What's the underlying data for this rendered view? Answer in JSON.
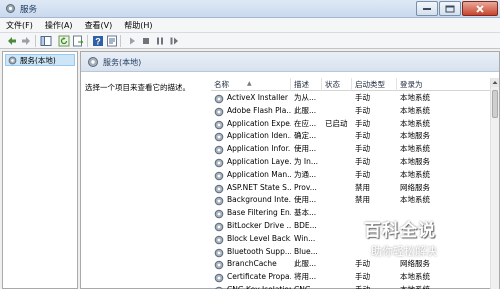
{
  "window": {
    "title": "服务",
    "controls": [
      "minimize-icon",
      "maximize-icon",
      "close-icon"
    ]
  },
  "menu": [
    "文件(F)",
    "操作(A)",
    "查看(V)",
    "帮助(H)"
  ],
  "toolbar": {
    "icons": [
      "back-arrow-icon",
      "forward-arrow-icon",
      "console-tree-icon",
      "refresh-icon",
      "export-list-icon",
      "help-icon",
      "properties-icon",
      "start-service-icon",
      "stop-service-icon",
      "pause-service-icon",
      "restart-service-icon"
    ]
  },
  "tree": {
    "item_label": "服务(本地)"
  },
  "main": {
    "header_title": "服务(本地)",
    "description_hint": "选择一个项目来查看它的描述。"
  },
  "table": {
    "columns": [
      "名称",
      "描述",
      "状态",
      "启动类型",
      "登录为"
    ],
    "rows": [
      [
        "ActiveX Installer ...",
        "为从...",
        "",
        "手动",
        "本地系统"
      ],
      [
        "Adobe Flash Pla...",
        "此服...",
        "",
        "手动",
        "本地系统"
      ],
      [
        "Application Expe...",
        "在应...",
        "已启动",
        "手动",
        "本地系统"
      ],
      [
        "Application Iden...",
        "确定...",
        "",
        "手动",
        "本地服务"
      ],
      [
        "Application Infor...",
        "使用...",
        "",
        "手动",
        "本地系统"
      ],
      [
        "Application Laye...",
        "为 In...",
        "",
        "手动",
        "本地服务"
      ],
      [
        "Application Man...",
        "为通...",
        "",
        "手动",
        "本地系统"
      ],
      [
        "ASP.NET State S...",
        "Prov...",
        "",
        "禁用",
        "网络服务"
      ],
      [
        "Background Inte...",
        "使用...",
        "",
        "禁用",
        "本地系统"
      ],
      [
        "Base Filtering En...",
        "基本...",
        "",
        "",
        ""
      ],
      [
        "BitLocker Drive ...",
        "BDE...",
        "",
        "",
        ""
      ],
      [
        "Block Level Back...",
        "Win...",
        "",
        "",
        ""
      ],
      [
        "Bluetooth Supp...",
        "Blue...",
        "",
        "",
        ""
      ],
      [
        "BranchCache",
        "此服...",
        "",
        "手动",
        "网络服务"
      ],
      [
        "Certificate Propa...",
        "将用...",
        "",
        "手动",
        "本地系统"
      ],
      [
        "CNG Key Isolation",
        "CNG...",
        "",
        "手动",
        "本地系统"
      ]
    ]
  },
  "watermark": {
    "title": "百科全说",
    "subtitle": "助你轻松解决"
  },
  "colors": {
    "selection": "#cde6f7",
    "titlebar": "#c9d9ee",
    "close": "#c7452f"
  }
}
